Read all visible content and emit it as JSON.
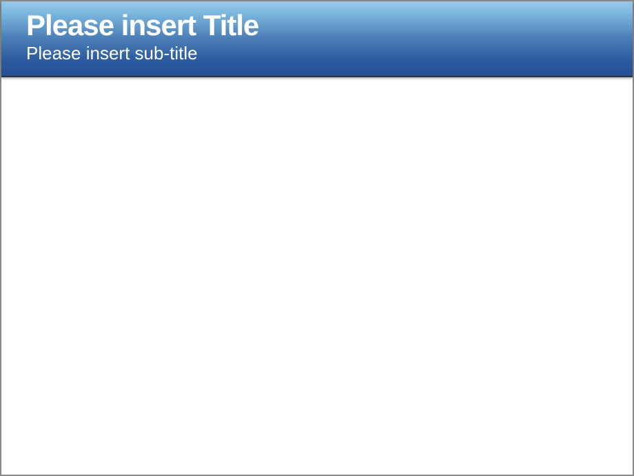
{
  "header": {
    "small_text": "",
    "title": "Please insert Title",
    "subtitle": "Please insert sub-title"
  }
}
